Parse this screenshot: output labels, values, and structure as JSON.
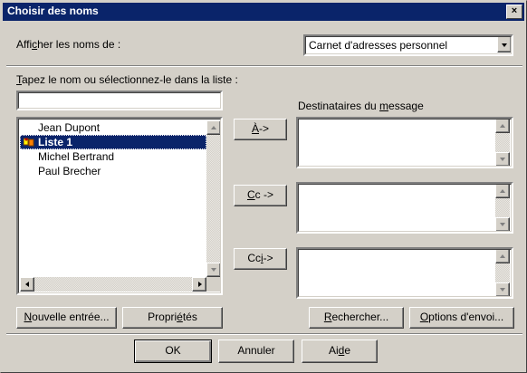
{
  "window": {
    "title": "Choisir des noms",
    "close_label": "×"
  },
  "show_names": {
    "label_pre": "Affi",
    "label_u": "c",
    "label_post": "her les noms de :",
    "selected_value": "Carnet d'adresses personnel"
  },
  "search": {
    "label_pre": "",
    "label_u": "T",
    "label_post": "apez le nom ou sélectionnez-le dans la liste :",
    "value": ""
  },
  "contacts": [
    {
      "name": "Jean Dupont",
      "selected": false,
      "icon": ""
    },
    {
      "name": "Liste 1",
      "selected": true,
      "icon": "group-icon"
    },
    {
      "name": "Michel Bertrand",
      "selected": false,
      "icon": ""
    },
    {
      "name": "Paul Brecher",
      "selected": false,
      "icon": ""
    }
  ],
  "recipients": {
    "label_pre": "Destinataires du ",
    "label_u": "m",
    "label_post": "essage",
    "to_button": {
      "u": "À",
      "rest": " ->"
    },
    "cc_button": {
      "u": "C",
      "rest": "c ->"
    },
    "bcc_button": {
      "pre": "Cc",
      "u": "i",
      "rest": " ->"
    }
  },
  "buttons": {
    "new_entry": {
      "u": "N",
      "rest": "ouvelle entrée..."
    },
    "properties": {
      "pre": "Propri",
      "u": "é",
      "rest": "tés"
    },
    "search": {
      "u": "R",
      "rest": "echercher..."
    },
    "send_options": {
      "u": "O",
      "rest": "ptions d'envoi..."
    },
    "ok": "OK",
    "cancel": "Annuler",
    "help": {
      "pre": "Ai",
      "u": "d",
      "rest": "e"
    }
  },
  "colors": {
    "face": "#d4d0c8",
    "title_bar": "#0a246a",
    "selection": "#0a246a",
    "field": "#ffffff"
  }
}
